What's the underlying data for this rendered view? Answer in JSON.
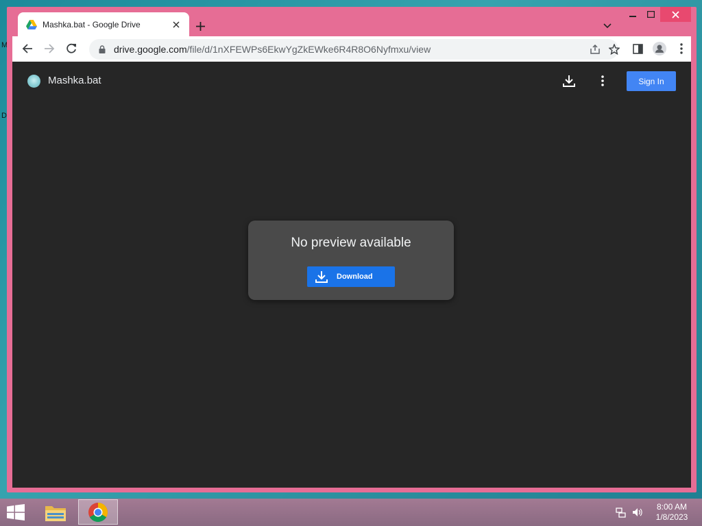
{
  "desktop": {
    "glyph_top": "M",
    "glyph_mid": "D"
  },
  "browser": {
    "tab": {
      "title": "Mashka.bat - Google Drive"
    },
    "url": {
      "host": "drive.google.com",
      "path": "/file/d/1nXFEWPs6EkwYgZkEWke6R4R8O6Nyfmxu/view"
    }
  },
  "drive": {
    "file_name": "Mashka.bat",
    "sign_in_label": "Sign In",
    "preview": {
      "message": "No preview available",
      "download_label": "Download"
    }
  },
  "taskbar": {
    "time": "8:00 AM",
    "date": "1/8/2023"
  },
  "colors": {
    "window_frame": "#e66d95",
    "page_bg": "#262626",
    "card_bg": "#4a4a4a",
    "primary_button": "#1a73e8",
    "sign_in_button": "#4285f4"
  }
}
